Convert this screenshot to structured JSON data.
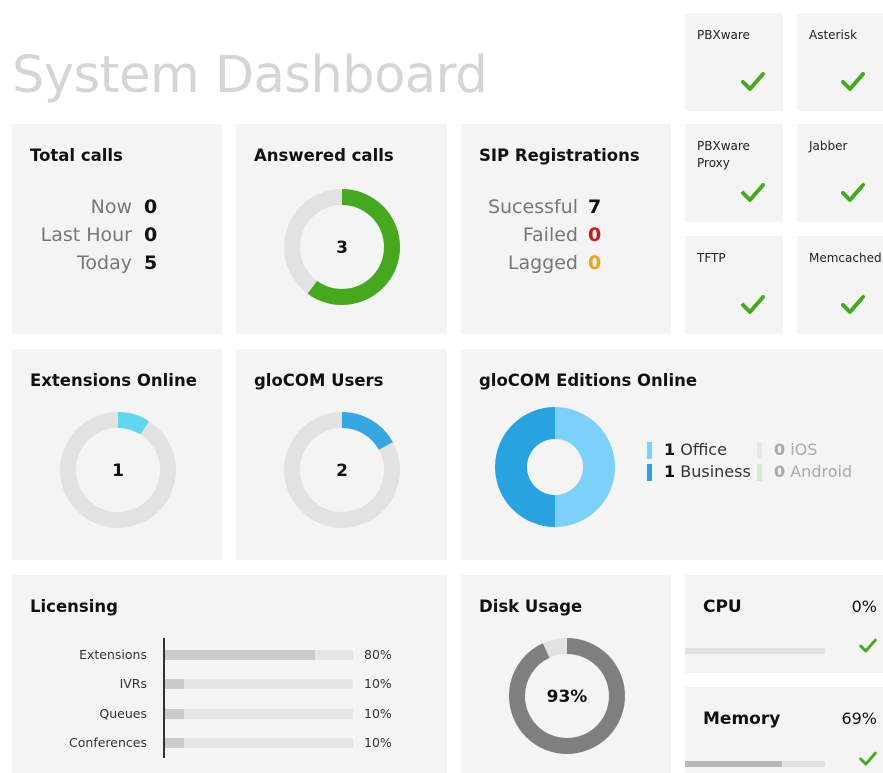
{
  "title": "System Dashboard",
  "services": [
    {
      "name": "PBXware",
      "status": "ok"
    },
    {
      "name": "Asterisk",
      "status": "ok"
    },
    {
      "name": "PBXware Proxy",
      "status": "ok"
    },
    {
      "name": "Jabber",
      "status": "ok"
    },
    {
      "name": "TFTP",
      "status": "ok"
    },
    {
      "name": "Memcached",
      "status": "ok"
    }
  ],
  "total_calls": {
    "title": "Total calls",
    "rows": [
      {
        "label": "Now",
        "value": "0"
      },
      {
        "label": "Last Hour",
        "value": "0"
      },
      {
        "label": "Today",
        "value": "5"
      }
    ]
  },
  "answered_calls": {
    "title": "Answered calls",
    "value": "3",
    "fraction": 0.6,
    "color": "#46a81e"
  },
  "sip": {
    "title": "SIP Registrations",
    "rows": [
      {
        "label": "Sucessful",
        "value": "7",
        "color": "#111111"
      },
      {
        "label": "Failed",
        "value": "0",
        "color": "#c0201a"
      },
      {
        "label": "Lagged",
        "value": "0",
        "color": "#e6a41a"
      }
    ]
  },
  "extensions_online": {
    "title": "Extensions Online",
    "value": "1",
    "fraction": 0.09,
    "color": "#5fd5f0"
  },
  "glocom_users": {
    "title": "gloCOM Users",
    "value": "2",
    "fraction": 0.17,
    "color": "#36a7e0"
  },
  "glocom_editions": {
    "title": "gloCOM Editions Online",
    "items": [
      {
        "count": "1",
        "label": "Office",
        "color": "#7dd1f8",
        "dim": false
      },
      {
        "count": "0",
        "label": "iOS",
        "color": "#e8e8e8",
        "dim": true
      },
      {
        "count": "1",
        "label": "Business",
        "color": "#29a3e0",
        "dim": false
      },
      {
        "count": "0",
        "label": "Android",
        "color": "#d7ead0",
        "dim": true
      }
    ]
  },
  "licensing": {
    "title": "Licensing",
    "rows": [
      {
        "label": "Extensions",
        "value": "80%",
        "fraction": 0.8
      },
      {
        "label": "IVRs",
        "value": "10%",
        "fraction": 0.1
      },
      {
        "label": "Queues",
        "value": "10%",
        "fraction": 0.1
      },
      {
        "label": "Conferences",
        "value": "10%",
        "fraction": 0.1
      }
    ]
  },
  "disk_usage": {
    "title": "Disk Usage",
    "value": "93%",
    "fraction": 0.93,
    "color": "#7f7f7f"
  },
  "cpu": {
    "title": "CPU",
    "value": "0%",
    "fraction": 0.0
  },
  "memory": {
    "title": "Memory",
    "value": "69%",
    "fraction": 0.69
  },
  "colors": {
    "check": "#46a81e",
    "track": "#e2e2e2"
  }
}
